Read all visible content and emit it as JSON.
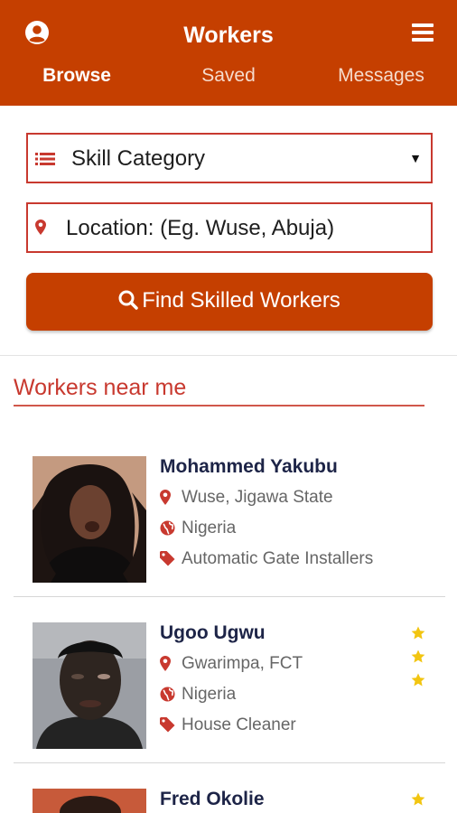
{
  "app": {
    "title": "Workers",
    "accent": "#c53f00",
    "profile_icon": "user-circle-icon",
    "menu_icon": "hamburger-menu-icon"
  },
  "tabs": [
    {
      "label": "Browse",
      "active": true
    },
    {
      "label": "Saved",
      "active": false
    },
    {
      "label": "Messages",
      "active": false
    }
  ],
  "search": {
    "category_label": "Skill Category",
    "category_icon": "list-icon",
    "location_placeholder": "Location: (Eg. Wuse, Abuja)",
    "location_icon": "map-marker-icon",
    "button_label": "Find Skilled Workers",
    "button_icon": "search-icon"
  },
  "section": {
    "title": "Workers near me"
  },
  "workers": [
    {
      "name": "Mohammed Yakubu",
      "location": "Wuse, Jigawa State",
      "country": "Nigeria",
      "skill": "Automatic Gate Installers",
      "stars": 0
    },
    {
      "name": "Ugoo Ugwu",
      "location": "Gwarimpa, FCT",
      "country": "Nigeria",
      "skill": "House Cleaner",
      "stars": 3
    },
    {
      "name": "Fred Okolie",
      "stars": 1
    }
  ],
  "colors": {
    "star": "#f2c511",
    "icon_red": "#c8392f"
  }
}
